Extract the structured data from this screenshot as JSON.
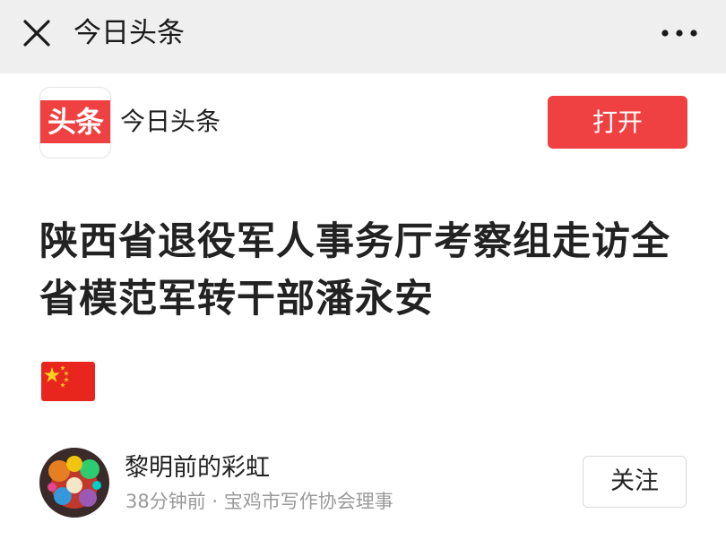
{
  "topbar": {
    "title": "今日头条",
    "close_icon": "close-icon",
    "more_icon": "more-dots-icon"
  },
  "app_banner": {
    "logo_text": "头条",
    "app_name": "今日头条",
    "open_label": "打开"
  },
  "article": {
    "title": "陕西省退役军人事务厅考察组走访全省模范军转干部潘永安",
    "emoji": "china-flag-icon"
  },
  "author": {
    "name": "黎明前的彩虹",
    "meta": "38分钟前 · 宝鸡市写作协会理事",
    "follow_label": "关注"
  },
  "colors": {
    "accent": "#f04142",
    "topbar_bg": "#efefef",
    "meta_text": "#9a9a9a"
  }
}
